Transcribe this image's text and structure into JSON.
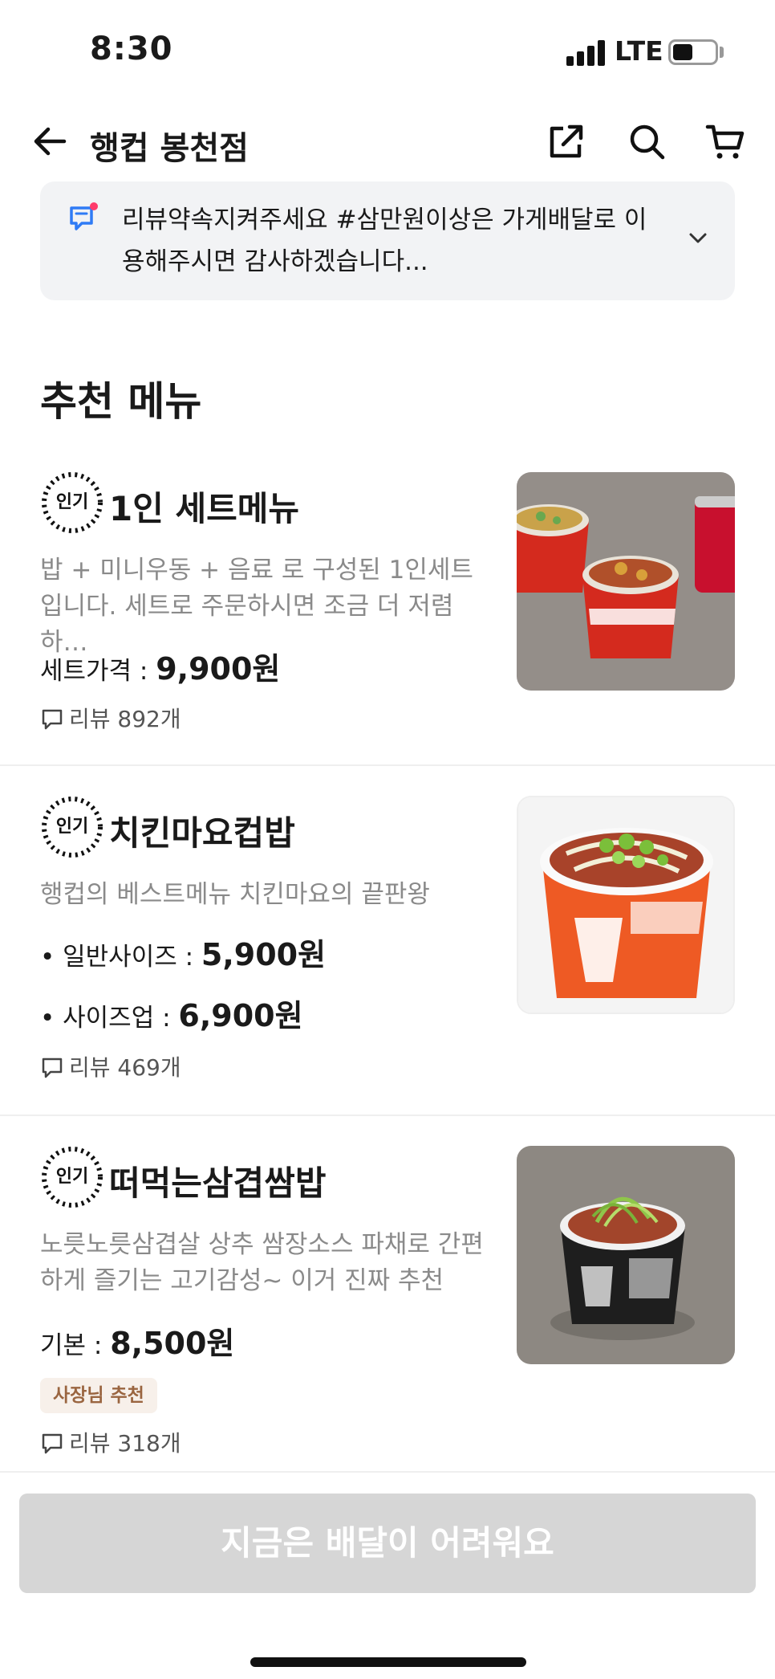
{
  "status_bar": {
    "time": "8:30",
    "network": "LTE"
  },
  "header": {
    "store_name": "행컵 봉천점"
  },
  "notice": {
    "text": "리뷰약속지켜주세요  #삼만원이상은 가게배달로 이용해주시면 감사하겠습니다..."
  },
  "section": {
    "title": "추천 메뉴"
  },
  "menu_items": [
    {
      "badge": "인기",
      "name": "1인 세트메뉴",
      "description": "밥 + 미니우동 + 음료 로 구성된 1인세트입니다. 세트로 주문하시면 조금 더 저렴하…",
      "prices": [
        {
          "label": "세트가격 : ",
          "amount": "9,900원"
        }
      ],
      "review": "리뷰 892개"
    },
    {
      "badge": "인기",
      "name": "치킨마요컵밥",
      "description": "행컵의 베스트메뉴 치킨마요의 끝판왕",
      "prices": [
        {
          "label": "• 일반사이즈 : ",
          "amount": "5,900원"
        },
        {
          "label": "• 사이즈업 : ",
          "amount": "6,900원"
        }
      ],
      "review": "리뷰 469개"
    },
    {
      "badge": "인기",
      "name": "떠먹는삼겹쌈밥",
      "description": "노릇노릇삼겹살 상추 쌈장소스 파채로 간편하게 즐기는 고기감성~ 이거 진짜 추천",
      "prices": [
        {
          "label": "기본 : ",
          "amount": "8,500원"
        }
      ],
      "tag": "사장님 추천",
      "review": "리뷰 318개"
    }
  ],
  "bottom": {
    "button_label": "지금은 배달이 어려워요"
  },
  "colors": {
    "accent_blue": "#2f7bf5",
    "notice_dot": "#ff3b6b",
    "disabled_button": "#d6d6d6"
  }
}
